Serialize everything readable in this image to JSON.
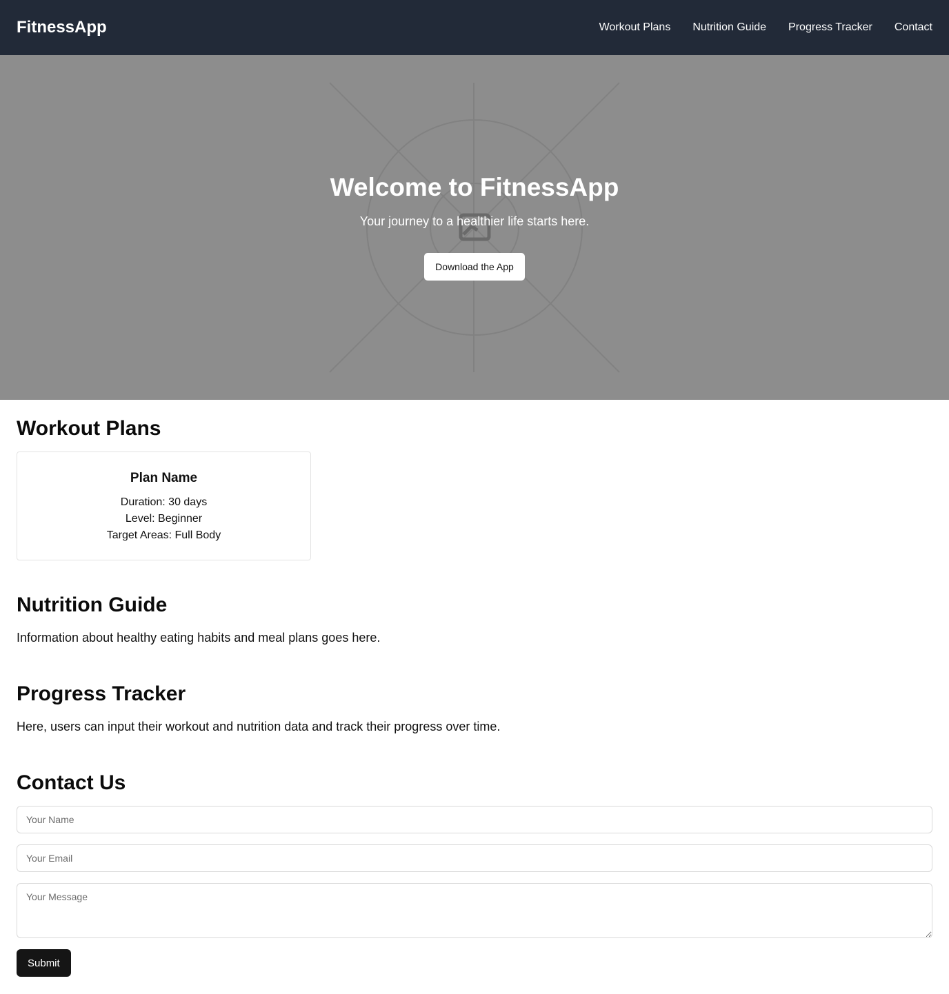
{
  "header": {
    "brand": "FitnessApp",
    "nav": [
      "Workout Plans",
      "Nutrition Guide",
      "Progress Tracker",
      "Contact"
    ]
  },
  "hero": {
    "title": "Welcome to FitnessApp",
    "subtitle": "Your journey to a healthier life starts here.",
    "button_label": "Download the App",
    "placeholder_icon": "image-placeholder-icon"
  },
  "workout": {
    "title": "Workout Plans",
    "plan": {
      "name": "Plan Name",
      "duration": "Duration: 30 days",
      "level": "Level: Beginner",
      "target": "Target Areas: Full Body"
    }
  },
  "nutrition": {
    "title": "Nutrition Guide",
    "text": "Information about healthy eating habits and meal plans goes here."
  },
  "progress": {
    "title": "Progress Tracker",
    "text": "Here, users can input their workout and nutrition data and track their progress over time."
  },
  "contact": {
    "title": "Contact Us",
    "name_placeholder": "Your Name",
    "email_placeholder": "Your Email",
    "message_placeholder": "Your Message",
    "submit_label": "Submit"
  },
  "colors": {
    "header_bg": "#222a38",
    "hero_bg": "#8d8d8d",
    "submit_bg": "#151515"
  }
}
